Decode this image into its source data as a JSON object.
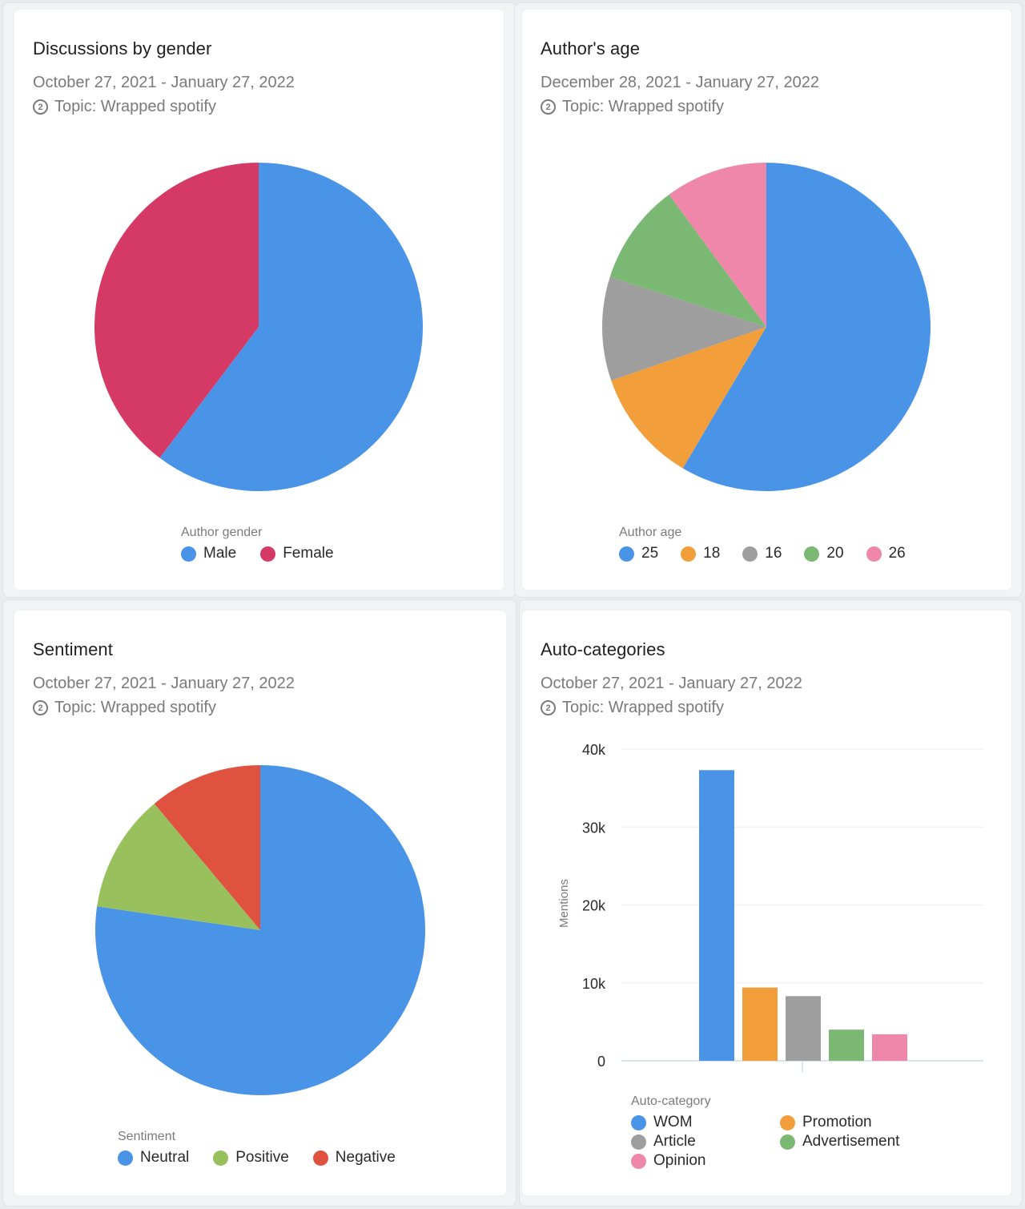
{
  "cards": [
    {
      "title": "Discussions by gender",
      "date_range": "October 27, 2021 - January 27, 2022",
      "topic_icon": "number-2-circle-icon",
      "topic_icon_glyph": "2",
      "topic": "Topic: Wrapped spotify",
      "legend_title": "Author gender"
    },
    {
      "title": "Author's age",
      "date_range": "December 28, 2021 - January 27, 2022",
      "topic_icon": "number-2-circle-icon",
      "topic_icon_glyph": "2",
      "topic": "Topic: Wrapped spotify",
      "legend_title": "Author age"
    },
    {
      "title": "Sentiment",
      "date_range": "October 27, 2021 - January 27, 2022",
      "topic_icon": "number-2-circle-icon",
      "topic_icon_glyph": "2",
      "topic": "Topic: Wrapped spotify",
      "legend_title": "Sentiment"
    },
    {
      "title": "Auto-categories",
      "date_range": "October 27, 2021 - January 27, 2022",
      "topic_icon": "number-2-circle-icon",
      "topic_icon_glyph": "2",
      "topic": "Topic: Wrapped spotify",
      "legend_title": "Auto-category"
    }
  ],
  "chart_data": [
    {
      "type": "pie",
      "title": "Discussions by gender",
      "legend_title": "Author gender",
      "legend_position": "bottom",
      "slices": [
        {
          "label": "Male",
          "value": 60.3,
          "color": "#4a94e8"
        },
        {
          "label": "Female",
          "value": 39.7,
          "color": "#d43a65"
        }
      ]
    },
    {
      "type": "pie",
      "title": "Author's age",
      "legend_title": "Author age",
      "legend_position": "bottom",
      "slices": [
        {
          "label": "25",
          "value": 58.5,
          "color": "#4a94e8"
        },
        {
          "label": "18",
          "value": 11.2,
          "color": "#f29e3b"
        },
        {
          "label": "16",
          "value": 10.2,
          "color": "#9e9e9e"
        },
        {
          "label": "20",
          "value": 10.0,
          "color": "#7ab873"
        },
        {
          "label": "26",
          "value": 10.1,
          "color": "#ee87a9"
        }
      ]
    },
    {
      "type": "pie",
      "title": "Sentiment",
      "legend_title": "Sentiment",
      "legend_position": "bottom",
      "slices": [
        {
          "label": "Neutral",
          "value": 77.3,
          "color": "#4a94e8"
        },
        {
          "label": "Positive",
          "value": 11.6,
          "color": "#98c05d"
        },
        {
          "label": "Negative",
          "value": 11.1,
          "color": "#e05240"
        }
      ]
    },
    {
      "type": "bar",
      "title": "Auto-categories",
      "xlabel": "",
      "ylabel": "Mentions",
      "ylim": [
        0,
        40000
      ],
      "yticks": [
        0,
        10000,
        20000,
        30000,
        40000
      ],
      "ytick_labels": [
        "0",
        "10k",
        "20k",
        "30k",
        "40k"
      ],
      "grid": true,
      "legend_title": "Auto-category",
      "legend_position": "bottom",
      "categories": [
        "WOM",
        "Promotion",
        "Article",
        "Advertisement",
        "Opinion"
      ],
      "values": [
        37300,
        9400,
        8300,
        4000,
        3400
      ],
      "colors": [
        "#4a94e8",
        "#f29e3b",
        "#9e9e9e",
        "#7ab873",
        "#ee87a9"
      ],
      "legend_order": [
        "WOM",
        "Promotion",
        "Article",
        "Advertisement",
        "Opinion"
      ]
    }
  ]
}
